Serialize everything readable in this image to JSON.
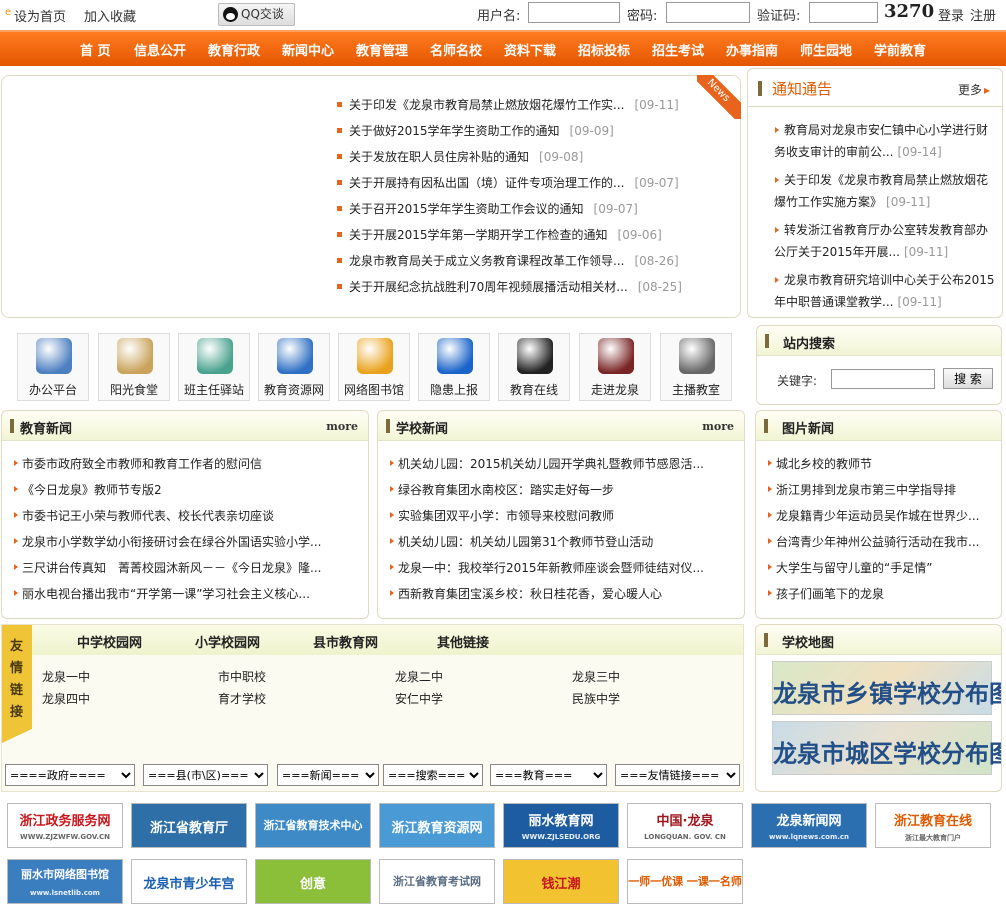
{
  "topbar": {
    "set_home": "设为首页",
    "add_fav": "加入收藏",
    "qq": "QQ交谈",
    "username_label": "用户名:",
    "password_label": "密码:",
    "captcha_label": "验证码:",
    "captcha_value": "3270",
    "login": "登录",
    "register": "注册"
  },
  "nav": [
    "首 页",
    "信息公开",
    "教育行政",
    "新闻中心",
    "教育管理",
    "名师名校",
    "资料下载",
    "招标投标",
    "招生考试",
    "办事指南",
    "师生园地",
    "学前教育"
  ],
  "headline_news": {
    "badge": "News",
    "items": [
      {
        "title": "关于印发《龙泉市教育局禁止燃放烟花爆竹工作实...",
        "date": "[09-11]"
      },
      {
        "title": "关于做好2015学年学生资助工作的通知",
        "date": "[09-09]"
      },
      {
        "title": "关于发放在职人员住房补贴的通知",
        "date": "[09-08]"
      },
      {
        "title": "关于开展持有因私出国（境）证件专项治理工作的...",
        "date": "[09-07]"
      },
      {
        "title": "关于召开2015学年学生资助工作会议的通知",
        "date": "[09-07]"
      },
      {
        "title": "关于开展2015学年第一学期开学工作检查的通知",
        "date": "[09-06]"
      },
      {
        "title": "龙泉市教育局关于成立义务教育课程改革工作领导...",
        "date": "[08-26]"
      },
      {
        "title": "关于开展纪念抗战胜利70周年视频展播活动相关材...",
        "date": "[08-25]"
      }
    ]
  },
  "notice": {
    "title": "通知通告",
    "more": "更多",
    "items": [
      {
        "title": "教育局对龙泉市安仁镇中心小学进行财务收支审计的审前公...",
        "date": "[09-14]"
      },
      {
        "title": "关于印发《龙泉市教育局禁止燃放烟花爆竹工作实施方案》",
        "date": "[09-11]"
      },
      {
        "title": "转发浙江省教育厅办公室转发教育部办公厅关于2015年开展...",
        "date": "[09-11]"
      },
      {
        "title": "龙泉市教育研究培训中心关于公布2015年中职普通课堂教学...",
        "date": "[09-11]"
      }
    ]
  },
  "site_search": {
    "title": "站内搜索",
    "keyword_label": "关键字:",
    "button": "搜 索"
  },
  "quick_links": [
    {
      "label": "办公平台",
      "icon": "computer-icon",
      "color": "#4d7fc1"
    },
    {
      "label": "阳光食堂",
      "icon": "food-icon",
      "color": "#c9a35b"
    },
    {
      "label": "班主任驿站",
      "icon": "teacher-icon",
      "color": "#49a28d"
    },
    {
      "label": "教育资源网",
      "icon": "globe-icon",
      "color": "#2f70c4"
    },
    {
      "label": "网络图书馆",
      "icon": "books-icon",
      "color": "#e9a21b"
    },
    {
      "label": "隐患上报",
      "icon": "safety-badge-icon",
      "color": "#1a63c9"
    },
    {
      "label": "教育在线",
      "icon": "graduate-icon",
      "color": "#222222"
    },
    {
      "label": "走进龙泉",
      "icon": "calligraphy-icon",
      "color": "#7a2525"
    },
    {
      "label": "主播教室",
      "icon": "camera-icon",
      "color": "#666666"
    }
  ],
  "edu_news": {
    "title": "教育新闻",
    "more": "more",
    "items": [
      "市委市政府致全市教师和教育工作者的慰问信",
      "《今日龙泉》教师节专版2",
      "市委书记王小荣与教师代表、校长代表亲切座谈",
      "龙泉市小学数学幼小衔接研讨会在绿谷外国语实验小学...",
      "三尺讲台传真知　菁菁校园沐新风－－《今日龙泉》隆...",
      "丽水电视台播出我市“开学第一课”学习社会主义核心..."
    ]
  },
  "school_news": {
    "title": "学校新闻",
    "more": "more",
    "items": [
      "机关幼儿园：2015机关幼儿园开学典礼暨教师节感恩活...",
      "绿谷教育集团水南校区：踏实走好每一步",
      "实验集团双平小学：市领导来校慰问教师",
      "机关幼儿园：机关幼儿园第31个教师节登山活动",
      "龙泉一中：我校举行2015年新教师座谈会暨师徒结对仪...",
      "西新教育集团宝溪乡校：秋日桂花香，爱心暖人心"
    ]
  },
  "photo_news": {
    "title": "图片新闻",
    "items": [
      "城北乡校的教师节",
      "浙江男排到龙泉市第三中学指导排",
      "龙泉籍青少年运动员吴作城在世界少...",
      "台湾青少年神州公益骑行活动在我市...",
      "大学生与留守儿童的“手足情”",
      "孩子们画笔下的龙泉"
    ]
  },
  "friend_links": {
    "side_label": [
      "友",
      "情",
      "链",
      "接"
    ],
    "tabs": [
      "中学校园网",
      "小学校园网",
      "县市教育网",
      "其他链接"
    ],
    "links": [
      "龙泉一中",
      "市中职校",
      "龙泉二中",
      "龙泉三中",
      "龙泉四中",
      "育才学校",
      "安仁中学",
      "民族中学"
    ]
  },
  "school_map": {
    "title": "学校地图",
    "maps": [
      "龙泉市乡镇学校分布图",
      "龙泉市城区学校分布图"
    ]
  },
  "selects": [
    "====政府====",
    "===县(市\\区)===",
    "===新闻===",
    "===搜索===",
    "===教育===",
    "===友情链接==="
  ],
  "banners": [
    {
      "label": "浙江政务服务网",
      "sub": "WWW.ZJZWFW.GOV.CN",
      "color": "#c8161d"
    },
    {
      "label": "浙江省教育厅",
      "sub": "",
      "color": "#ffffff",
      "bg": "#2f6fa7"
    },
    {
      "label": "浙江省教育技术中心",
      "sub": "",
      "color": "#ffffff",
      "bg": "#3d8ac6"
    },
    {
      "label": "浙江教育资源网",
      "sub": "",
      "color": "#ffffff",
      "bg": "#4a9ad6"
    },
    {
      "label": "丽水教育网",
      "sub": "WWW.ZJLSEDU.ORG",
      "color": "#ffffff",
      "bg": "#1d5ca0"
    },
    {
      "label": "中国·龙泉",
      "sub": "LONGQUAN. GOV. CN",
      "color": "#a0161c"
    },
    {
      "label": "龙泉新闻网",
      "sub": "www.lqnews.com.cn",
      "color": "#ffffff",
      "bg": "#2b6fb0"
    },
    {
      "label": "浙江教育在线",
      "sub": "浙江最大教育门户",
      "color": "#e05a00"
    },
    {
      "label": "丽水市网络图书馆",
      "sub": "www.lsnetlib.com",
      "color": "#ffffff",
      "bg": "#3b7ec0"
    },
    {
      "label": "龙泉市青少年宫",
      "sub": "",
      "color": "#1a5fb4"
    },
    {
      "label": "创意",
      "sub": "",
      "color": "#ffffff",
      "bg": "#8bbf3a"
    },
    {
      "label": "浙江省教育考试网",
      "sub": "",
      "color": "#5a6c84"
    },
    {
      "label": "钱江潮",
      "sub": "",
      "color": "#c8161d",
      "bg": "#f2c230"
    },
    {
      "label": "一师一优课 一课一名师",
      "sub": "",
      "color": "#e05a00"
    }
  ]
}
